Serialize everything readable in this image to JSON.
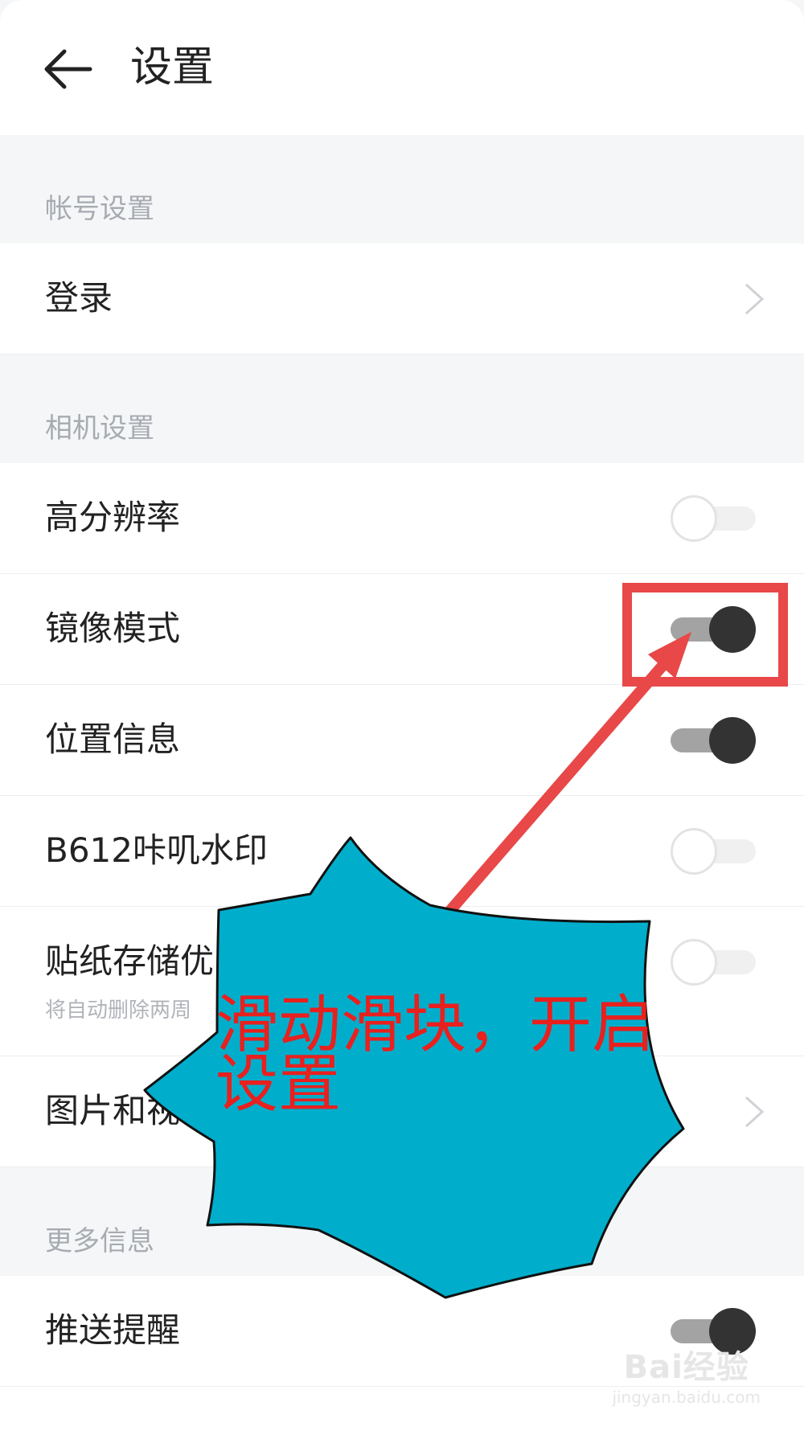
{
  "header": {
    "title": "设置",
    "back_icon": "back-arrow-icon"
  },
  "sections": [
    {
      "label": "帐号设置"
    },
    {
      "label": "相机设置"
    },
    {
      "label": "更多信息"
    }
  ],
  "rows": [
    {
      "label": "登录",
      "control": "chevron"
    },
    {
      "label": "高分辨率",
      "control": "toggle",
      "on": false
    },
    {
      "label": "镜像模式",
      "control": "toggle",
      "on": true
    },
    {
      "label": "位置信息",
      "control": "toggle",
      "on": true
    },
    {
      "label": "B612咔叽水印",
      "control": "toggle",
      "on": false
    },
    {
      "label": "贴纸存储优",
      "sublabel": "将自动删除两周",
      "control": "toggle",
      "on": false
    },
    {
      "label": "图片和视",
      "control": "chevron"
    },
    {
      "label": "推送提醒",
      "control": "toggle",
      "on": true
    }
  ],
  "annotation": {
    "text": "滑动滑块，开启设置",
    "line1": "滑动滑块，开启",
    "line2": "设置",
    "highlight_color": "#e84848",
    "callout_color": "#00aecc",
    "text_color": "#e8201e"
  },
  "watermark": {
    "main": "Bai经验",
    "sub": "jingyan.baidu.com"
  }
}
